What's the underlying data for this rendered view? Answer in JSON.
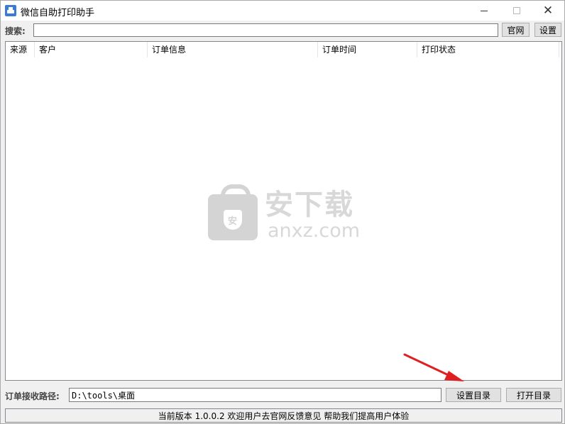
{
  "window": {
    "title": "微信自助打印助手",
    "icons": {
      "app": "printer-icon",
      "minimize": "minimize-icon",
      "maximize": "maximize-icon",
      "close": "close-icon"
    },
    "close_glyph": "✕"
  },
  "search": {
    "label": "搜索:",
    "value": "",
    "placeholder": "",
    "site_button": "官网",
    "settings_button": "设置"
  },
  "table": {
    "columns": [
      "来源",
      "客户",
      "订单信息",
      "订单时间",
      "打印状态"
    ],
    "rows": []
  },
  "watermark": {
    "cn": "安下载",
    "en": "anxz.com"
  },
  "path": {
    "label": "订单接收路径:",
    "value": "D:\\tools\\桌面",
    "set_dir_button": "设置目录",
    "open_dir_button": "打开目录"
  },
  "status": {
    "text": "当前版本 1.0.0.2 欢迎用户去官网反馈意见 帮助我们提高用户体验"
  },
  "colors": {
    "arrow": "#e02020",
    "accent": "#3a7bd5"
  }
}
